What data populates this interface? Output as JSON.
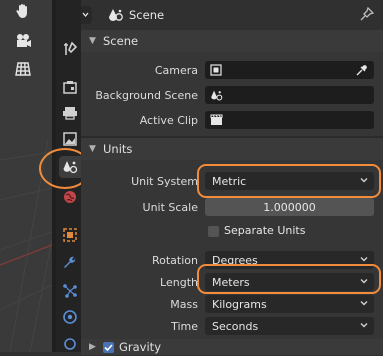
{
  "header": {
    "context_title": "Scene"
  },
  "scene_panel": {
    "title": "Scene",
    "fields": [
      {
        "label": "Camera",
        "value": ""
      },
      {
        "label": "Background Scene",
        "value": ""
      },
      {
        "label": "Active Clip",
        "value": ""
      }
    ]
  },
  "units_panel": {
    "title": "Units",
    "unit_system": {
      "label": "Unit System",
      "value": "Metric"
    },
    "unit_scale": {
      "label": "Unit Scale",
      "value": "1.000000"
    },
    "separate_units": {
      "label": "Separate Units",
      "checked": false
    },
    "rotation": {
      "label": "Rotation",
      "value": "Degrees"
    },
    "length": {
      "label": "Length",
      "value": "Meters"
    },
    "mass": {
      "label": "Mass",
      "value": "Kilograms"
    },
    "time": {
      "label": "Time",
      "value": "Seconds"
    }
  },
  "gravity_panel": {
    "title": "Gravity",
    "checked": true
  },
  "colors": {
    "highlight": "#f08c3c",
    "accent": "#4772b3"
  }
}
